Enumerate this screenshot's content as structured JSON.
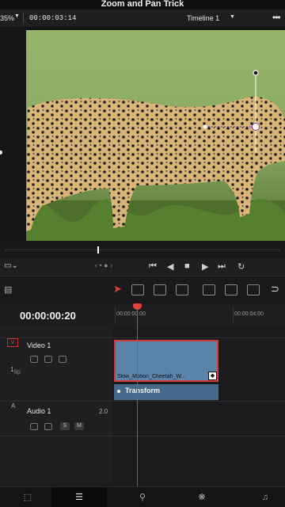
{
  "app": {
    "title": "Zoom and Pan Trick"
  },
  "toolbar": {
    "zoom_value": "35%",
    "clip_timecode": "00:00:03:14",
    "timeline_name": "Timeline 1"
  },
  "viewer": {
    "image_subject": "cheetah walking through grass",
    "handle_icon": "transform-handle-icon"
  },
  "transport": {
    "view_mode_icon": "viewer-mode-icon",
    "prev_icon": "jump-to-start-icon",
    "step_back_icon": "step-back-icon",
    "stop_icon": "stop-icon",
    "play_icon": "play-icon",
    "next_icon": "jump-to-end-icon",
    "loop_icon": "loop-icon"
  },
  "timeline": {
    "current_timecode": "00:00:00:20",
    "ruler_labels": [
      "00:00:00:00",
      "00:00:04:00"
    ],
    "tracks": [
      {
        "badge": "V",
        "name": "Video 1",
        "clip_label": "1",
        "side_text": "lip"
      },
      {
        "badge": "A",
        "name": "Audio 1",
        "channels": "2.0",
        "solo": "S",
        "mute": "M"
      }
    ],
    "clip": {
      "name": "Slow_Motion_Cheetah_W..."
    },
    "transform": {
      "label": "Transform"
    }
  },
  "colors": {
    "accent_red": "#d33a3a",
    "clip_blue": "#5b84a8",
    "transform_blue": "#47698b",
    "background": "#1c1c1e"
  }
}
